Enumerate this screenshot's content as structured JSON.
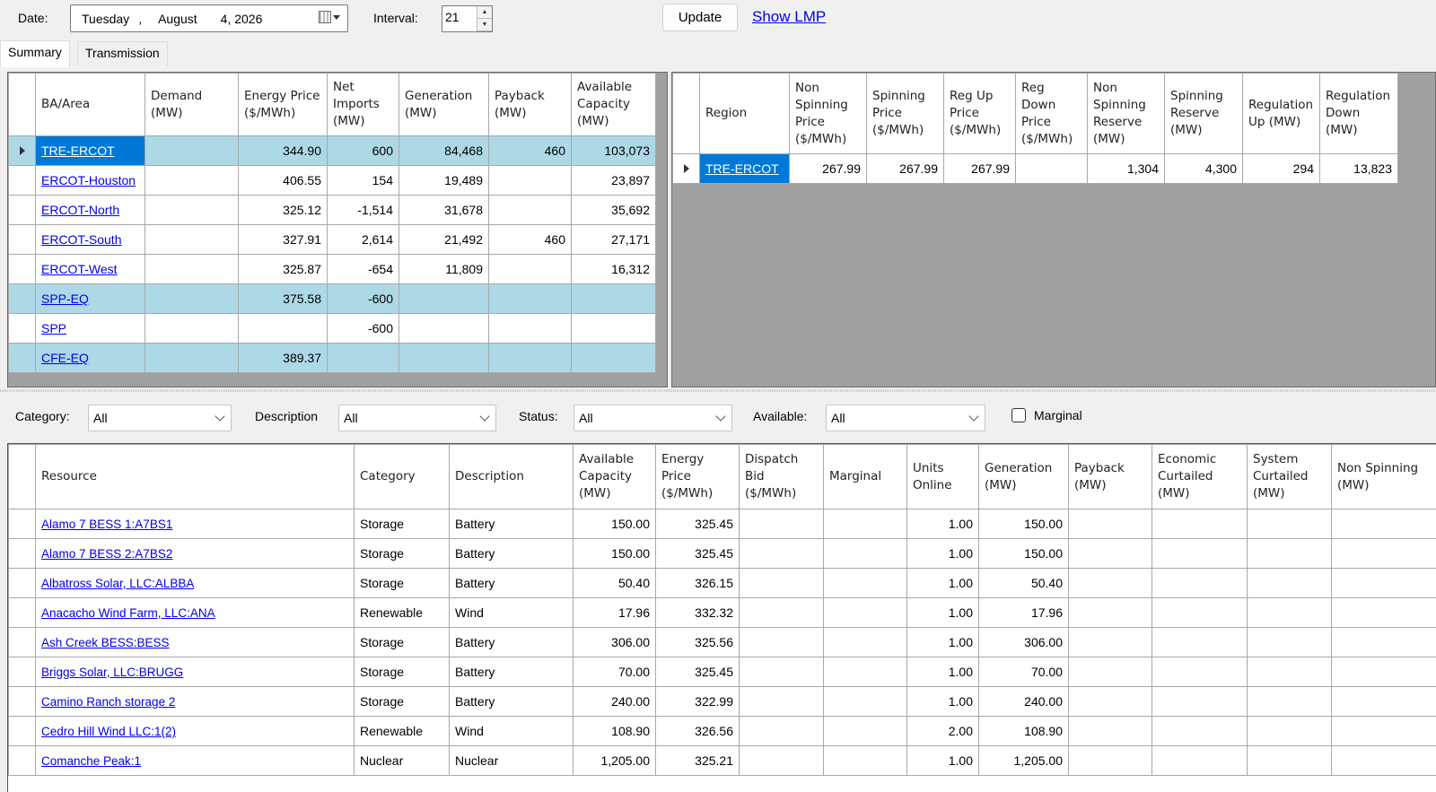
{
  "toolbar": {
    "date_label": "Date:",
    "date_weekday": "Tuesday",
    "date_sep": ",",
    "date_month": "August",
    "date_daysyear": "4, 2026",
    "interval_label": "Interval:",
    "interval_value": "21",
    "update_label": "Update",
    "show_lmp_label": "Show LMP"
  },
  "tabs": [
    {
      "label": "Summary",
      "active": true
    },
    {
      "label": "Transmission",
      "active": false
    }
  ],
  "ba_table": {
    "headers": [
      "BA/Area",
      "Demand (MW)",
      "Energy Price ($/MWh)",
      "Net Imports (MW)",
      "Generation (MW)",
      "Payback (MW)",
      "Available Capacity (MW)"
    ],
    "rows": [
      {
        "area": "TRE-ERCOT",
        "demand": "",
        "price": "344.90",
        "imports": "600",
        "generation": "84,468",
        "payback": "460",
        "capacity": "103,073",
        "highlight": true,
        "selected": true
      },
      {
        "area": "ERCOT-Houston",
        "demand": "",
        "price": "406.55",
        "imports": "154",
        "generation": "19,489",
        "payback": "",
        "capacity": "23,897"
      },
      {
        "area": "ERCOT-North",
        "demand": "",
        "price": "325.12",
        "imports": "-1,514",
        "generation": "31,678",
        "payback": "",
        "capacity": "35,692"
      },
      {
        "area": "ERCOT-South",
        "demand": "",
        "price": "327.91",
        "imports": "2,614",
        "generation": "21,492",
        "payback": "460",
        "capacity": "27,171"
      },
      {
        "area": "ERCOT-West",
        "demand": "",
        "price": "325.87",
        "imports": "-654",
        "generation": "11,809",
        "payback": "",
        "capacity": "16,312"
      },
      {
        "area": "SPP-EQ",
        "demand": "",
        "price": "375.58",
        "imports": "-600",
        "generation": "",
        "payback": "",
        "capacity": "",
        "highlight": true
      },
      {
        "area": "SPP",
        "demand": "",
        "price": "",
        "imports": "-600",
        "generation": "",
        "payback": "",
        "capacity": ""
      },
      {
        "area": "CFE-EQ",
        "demand": "",
        "price": "389.37",
        "imports": "",
        "generation": "",
        "payback": "",
        "capacity": "",
        "highlight": true
      }
    ]
  },
  "region_table": {
    "headers": [
      "Region",
      "Non Spinning Price ($/MWh)",
      "Spinning Price ($/MWh)",
      "Reg Up Price ($/MWh)",
      "Reg Down Price ($/MWh)",
      "Non Spinning Reserve (MW)",
      "Spinning Reserve (MW)",
      "Regulation Up (MW)",
      "Regulation Down (MW)"
    ],
    "rows": [
      {
        "region": "TRE-ERCOT",
        "values": [
          "267.99",
          "267.99",
          "267.99",
          "",
          "1,304",
          "4,300",
          "294",
          "13,823"
        ]
      }
    ]
  },
  "filters": {
    "category_label": "Category:",
    "category_value": "All",
    "description_label": "Description",
    "description_value": "All",
    "status_label": "Status:",
    "status_value": "All",
    "available_label": "Available:",
    "available_value": "All",
    "marginal_label": "Marginal",
    "marginal_checked": false
  },
  "resource_table": {
    "headers": [
      "Resource",
      "Category",
      "Description",
      "Available Capacity (MW)",
      "Energy Price ($/MWh)",
      "Dispatch Bid ($/MWh)",
      "Marginal",
      "Units Online",
      "Generation (MW)",
      "Payback (MW)",
      "Economic Curtailed (MW)",
      "System Curtailed (MW)",
      "Non Spinning (MW)"
    ],
    "rows": [
      {
        "resource": "Alamo 7 BESS 1:A7BS1",
        "category": "Storage",
        "description": "Battery",
        "capacity": "150.00",
        "price": "325.45",
        "bid": "",
        "marginal": "",
        "units": "1.00",
        "generation": "150.00"
      },
      {
        "resource": "Alamo 7 BESS 2:A7BS2",
        "category": "Storage",
        "description": "Battery",
        "capacity": "150.00",
        "price": "325.45",
        "bid": "",
        "marginal": "",
        "units": "1.00",
        "generation": "150.00"
      },
      {
        "resource": "Albatross Solar, LLC:ALBBA",
        "category": "Storage",
        "description": "Battery",
        "capacity": "50.40",
        "price": "326.15",
        "bid": "",
        "marginal": "",
        "units": "1.00",
        "generation": "50.40"
      },
      {
        "resource": "Anacacho Wind Farm, LLC:ANA",
        "category": "Renewable",
        "description": "Wind",
        "capacity": "17.96",
        "price": "332.32",
        "bid": "",
        "marginal": "",
        "units": "1.00",
        "generation": "17.96"
      },
      {
        "resource": "Ash Creek BESS:BESS",
        "category": "Storage",
        "description": "Battery",
        "capacity": "306.00",
        "price": "325.56",
        "bid": "",
        "marginal": "",
        "units": "1.00",
        "generation": "306.00"
      },
      {
        "resource": "Briggs Solar, LLC:BRUGG",
        "category": "Storage",
        "description": "Battery",
        "capacity": "70.00",
        "price": "325.45",
        "bid": "",
        "marginal": "",
        "units": "1.00",
        "generation": "70.00"
      },
      {
        "resource": "Camino Ranch storage 2",
        "category": "Storage",
        "description": "Battery",
        "capacity": "240.00",
        "price": "322.99",
        "bid": "",
        "marginal": "",
        "units": "1.00",
        "generation": "240.00"
      },
      {
        "resource": "Cedro Hill Wind LLC:1(2)",
        "category": "Renewable",
        "description": "Wind",
        "capacity": "108.90",
        "price": "326.56",
        "bid": "",
        "marginal": "",
        "units": "2.00",
        "generation": "108.90"
      },
      {
        "resource": "Comanche Peak:1",
        "category": "Nuclear",
        "description": "Nuclear",
        "capacity": "1,205.00",
        "price": "325.21",
        "bid": "",
        "marginal": "",
        "units": "1.00",
        "generation": "1,205.00"
      }
    ]
  },
  "colors": {
    "highlight_row": "#add8e6",
    "selected_cell": "#0078d7",
    "link": "#0000ee",
    "empty_grid_bg": "#a0a0a0"
  }
}
